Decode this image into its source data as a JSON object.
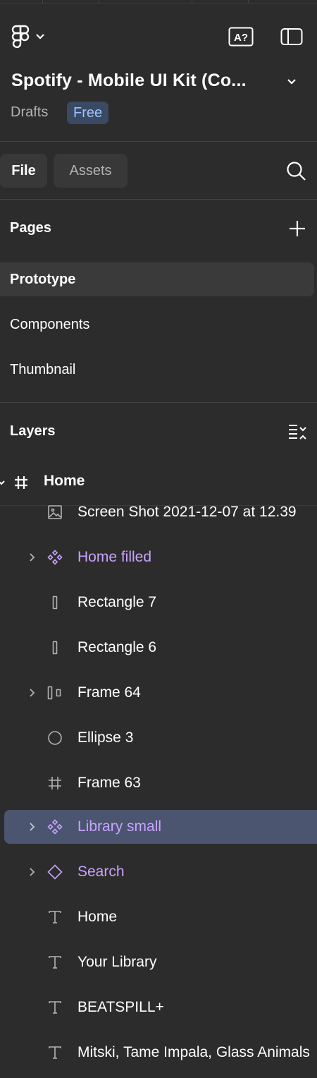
{
  "header": {
    "file_title": "Spotify - Mobile UI Kit (Co...",
    "location": "Drafts",
    "plan_badge": "Free",
    "icons": {
      "logo": "figma-logo-icon",
      "menu": "chevron-down-icon",
      "ai": "ai-translate-icon",
      "panel": "sidebar-toggle-icon"
    }
  },
  "tabs": [
    {
      "label": "File",
      "active": true
    },
    {
      "label": "Assets",
      "active": false
    }
  ],
  "pages": {
    "title": "Pages",
    "items": [
      {
        "label": "Prototype",
        "selected": true
      },
      {
        "label": "Components",
        "selected": false
      },
      {
        "label": "Thumbnail",
        "selected": false
      }
    ]
  },
  "layers": {
    "title": "Layers",
    "frame": {
      "label": "Home",
      "icon": "frame-hash-icon"
    },
    "items": [
      {
        "label": "Screen Shot 2021-12-07 at 12.39",
        "icon": "image-icon",
        "expandable": false,
        "component": false,
        "selected": false
      },
      {
        "label": "Home filled",
        "icon": "component-icon",
        "expandable": true,
        "component": true,
        "selected": false
      },
      {
        "label": "Rectangle 7",
        "icon": "rectangle-icon",
        "expandable": false,
        "component": false,
        "selected": false
      },
      {
        "label": "Rectangle 6",
        "icon": "rectangle-icon",
        "expandable": false,
        "component": false,
        "selected": false
      },
      {
        "label": "Frame 64",
        "icon": "auto-layout-icon",
        "expandable": true,
        "component": false,
        "selected": false
      },
      {
        "label": "Ellipse 3",
        "icon": "ellipse-icon",
        "expandable": false,
        "component": false,
        "selected": false
      },
      {
        "label": "Frame 63",
        "icon": "frame-hash-icon",
        "expandable": false,
        "component": false,
        "selected": false
      },
      {
        "label": "Library small",
        "icon": "component-icon",
        "expandable": true,
        "component": true,
        "selected": true
      },
      {
        "label": "Search",
        "icon": "instance-icon",
        "expandable": true,
        "component": true,
        "selected": false
      },
      {
        "label": "Home",
        "icon": "text-icon",
        "expandable": false,
        "component": false,
        "selected": false
      },
      {
        "label": "Your Library",
        "icon": "text-icon",
        "expandable": false,
        "component": false,
        "selected": false
      },
      {
        "label": "BEATSPILL+",
        "icon": "text-icon",
        "expandable": false,
        "component": false,
        "selected": false
      },
      {
        "label": "Mitski, Tame Impala, Glass Animals",
        "icon": "text-icon",
        "expandable": false,
        "component": false,
        "selected": false
      }
    ]
  },
  "colors": {
    "background": "#2c2c2c",
    "component_text": "#c7a4ff",
    "selection": "#4b556f",
    "badge_bg": "#3a4a63",
    "badge_text": "#9dc3ff"
  }
}
